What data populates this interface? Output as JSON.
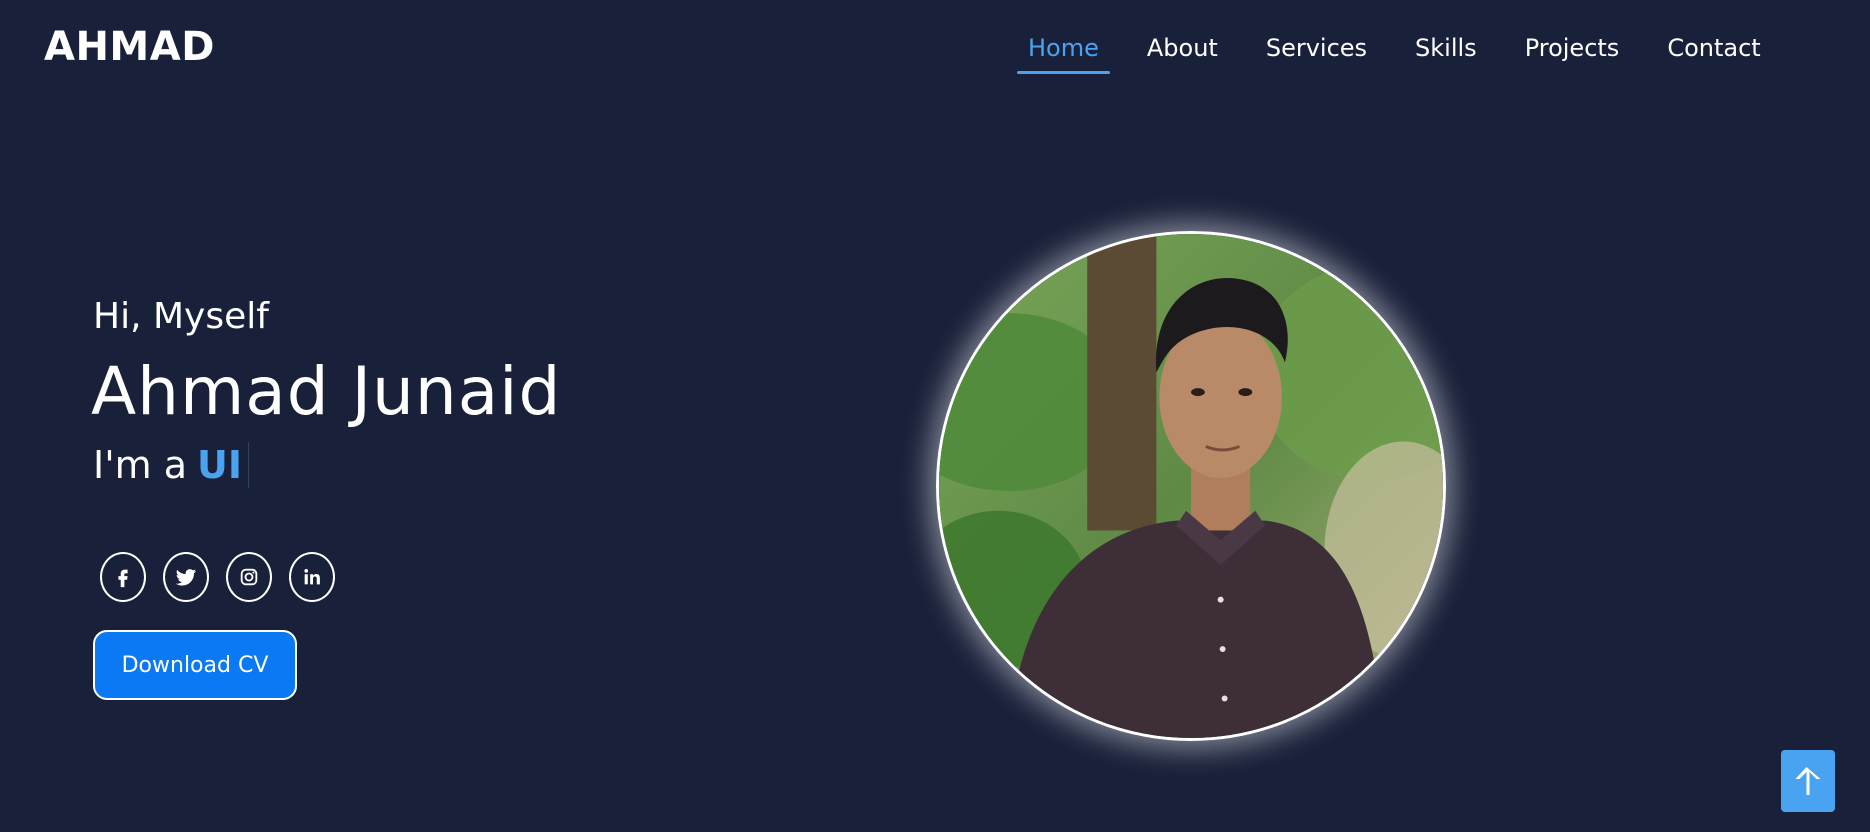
{
  "header": {
    "logo": "AHMAD",
    "nav": [
      {
        "label": "Home",
        "active": true
      },
      {
        "label": "About",
        "active": false
      },
      {
        "label": "Services",
        "active": false
      },
      {
        "label": "Skills",
        "active": false
      },
      {
        "label": "Projects",
        "active": false
      },
      {
        "label": "Contact",
        "active": false
      }
    ]
  },
  "hero": {
    "greeting": "Hi, Myself",
    "name": "Ahmad Junaid",
    "role_prefix": "I'm a",
    "role_word": "UI",
    "socials": [
      {
        "icon": "facebook-icon"
      },
      {
        "icon": "twitter-icon"
      },
      {
        "icon": "instagram-icon"
      },
      {
        "icon": "linkedin-icon"
      }
    ],
    "download_label": "Download CV"
  },
  "colors": {
    "background": "#19213a",
    "accent": "#4aa3f0",
    "button": "#0b78f4"
  },
  "icons": {
    "scroll_top": "arrow-up-icon"
  }
}
